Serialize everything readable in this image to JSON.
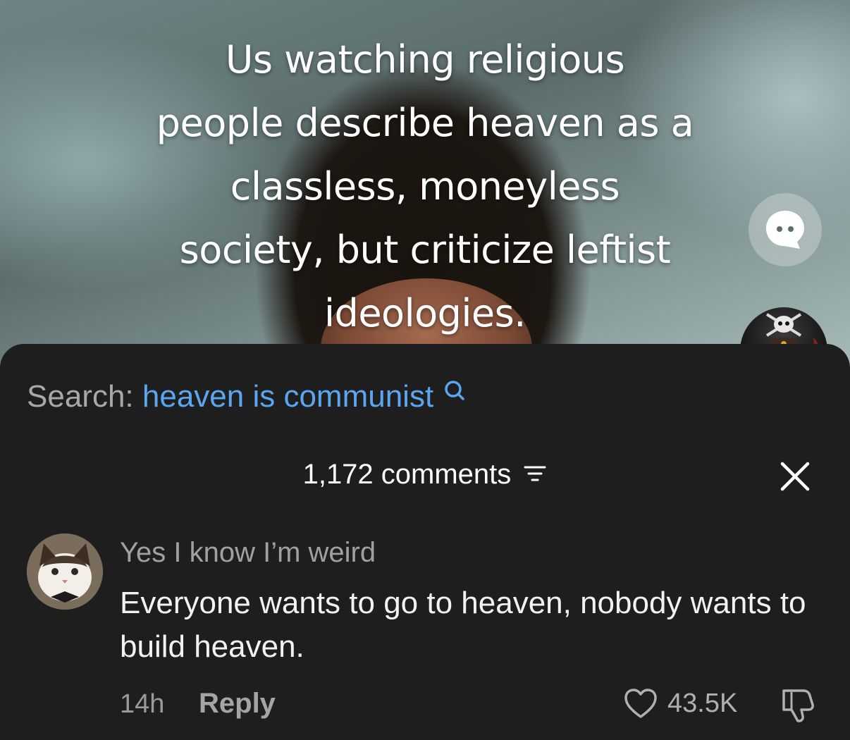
{
  "video": {
    "caption_lines": [
      "Us watching religious",
      "people describe heaven as a",
      "classless, moneyless",
      "society, but criticize leftist",
      "ideologies."
    ],
    "chat_icon": "chat-bubble-icon",
    "creator_avatar_icon": "skull-crossbones-icon"
  },
  "comments_panel": {
    "search_label": "Search:",
    "search_term": "heaven is communist",
    "search_icon": "search-icon",
    "count_label": "1,172 comments",
    "sort_icon": "sort-filter-icon",
    "close_icon": "close-icon",
    "comment": {
      "username": "Yes I know I’m weird",
      "text": "Everyone wants to go to heaven, nobody wants to build heaven.",
      "time": "14h",
      "reply_label": "Reply",
      "likes": "43.5K",
      "like_icon": "heart-icon",
      "dislike_icon": "thumbs-down-icon"
    }
  },
  "colors": {
    "sheet_background": "#1e1e1e",
    "search_term": "#5aa6f0",
    "secondary_text": "#a0a0a0"
  }
}
